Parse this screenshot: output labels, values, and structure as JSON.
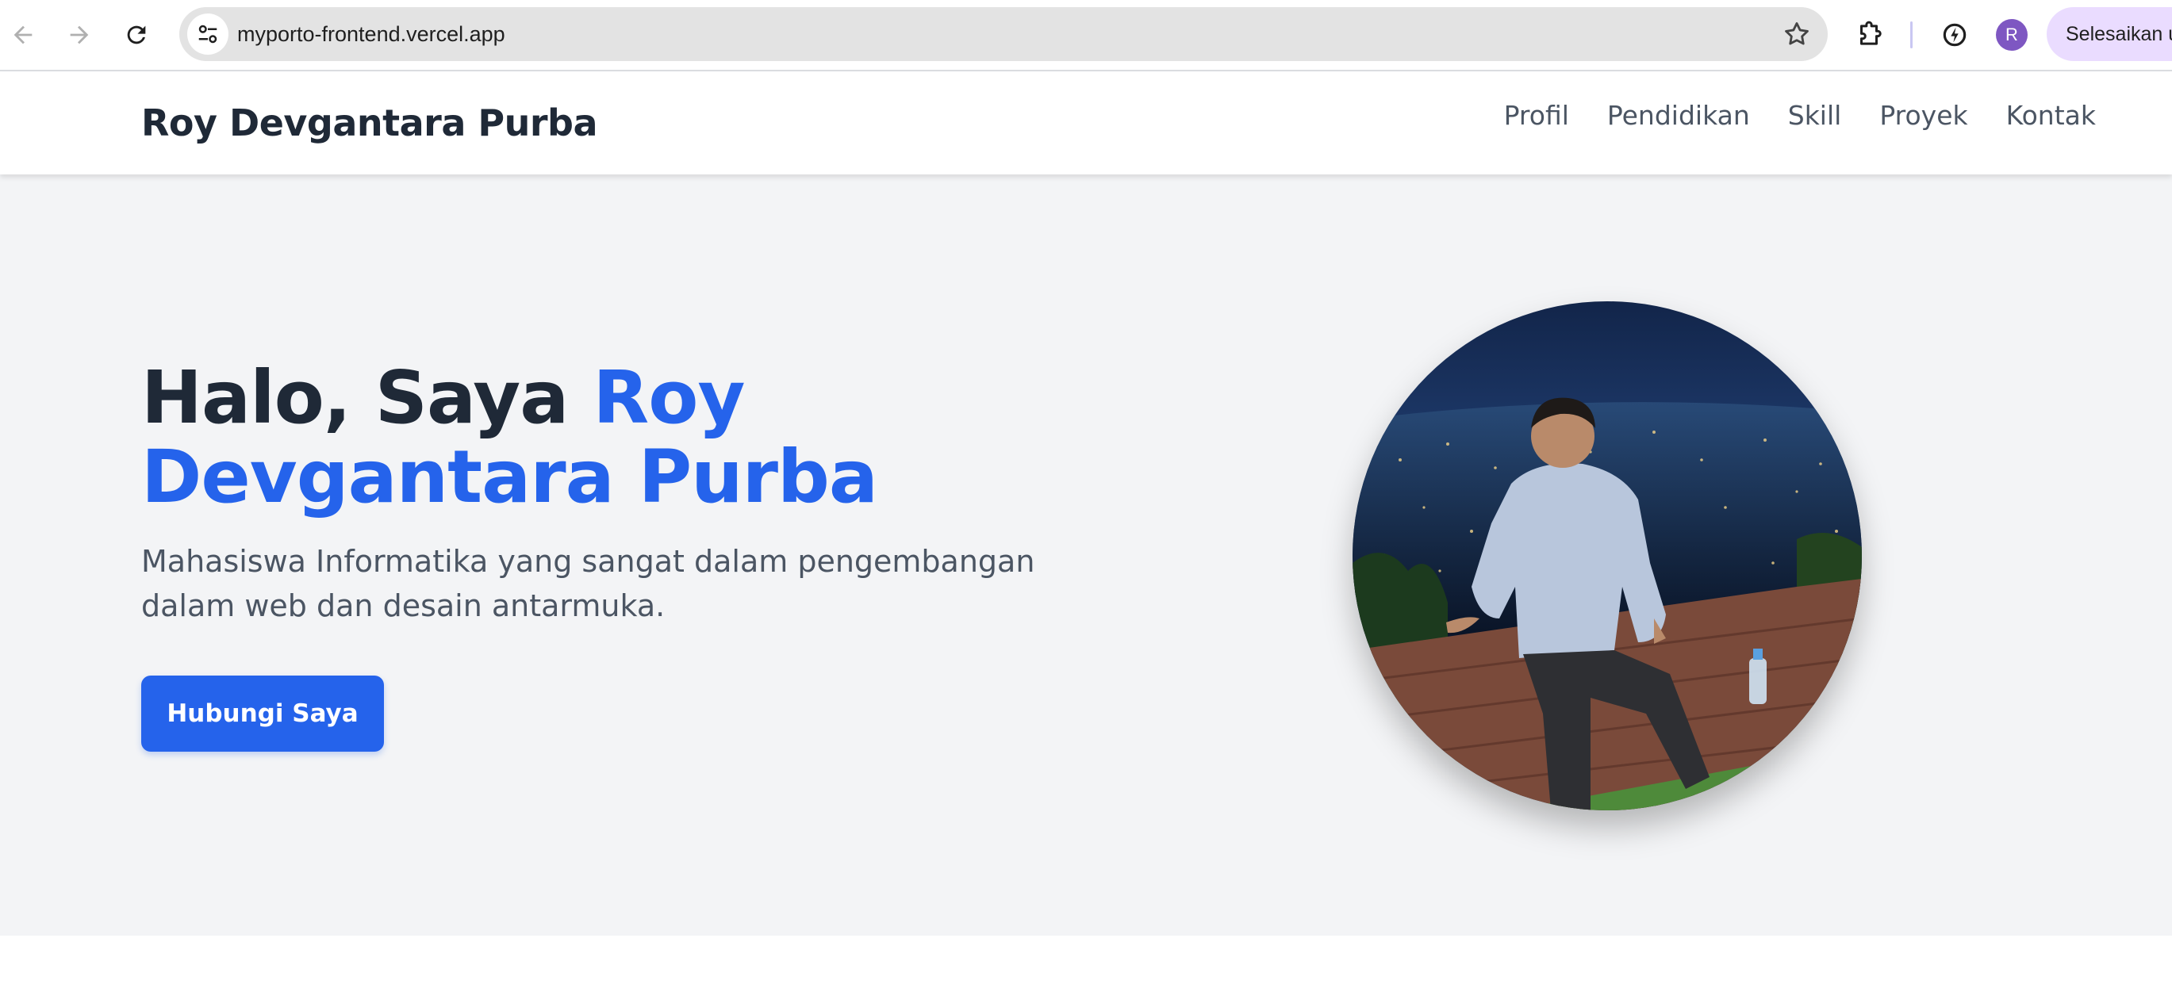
{
  "browser": {
    "url": "myporto-frontend.vercel.app",
    "profile_initial": "R",
    "update_label": "Selesaikan update",
    "icons": [
      "back-arrow-icon",
      "forward-arrow-icon",
      "reload-icon",
      "site-settings-icon",
      "bookmark-star-icon",
      "extensions-icon",
      "performance-icon"
    ]
  },
  "navbar": {
    "brand": "Roy Devgantara Purba",
    "links": [
      "Profil",
      "Pendidikan",
      "Skill",
      "Proyek",
      "Kontak"
    ]
  },
  "hero": {
    "greeting": "Halo, Saya ",
    "name": "Roy Devgantara Purba",
    "subtitle": "Mahasiswa Informatika yang sangat dalam pengembangan dalam web dan desain antarmuka.",
    "cta_label": "Hubungi Saya"
  },
  "colors": {
    "accent": "#2563eb",
    "heading": "#1f2937",
    "body_text": "#4b5563",
    "hero_bg": "#f3f4f6",
    "avatar_bg": "#7e57c2",
    "update_pill_bg": "#eadcff"
  }
}
